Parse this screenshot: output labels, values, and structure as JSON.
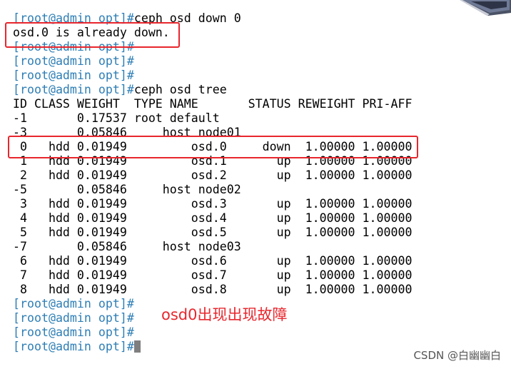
{
  "terminal": {
    "prompt_text": "[root@admin opt]#",
    "lines": {
      "l0": {
        "prompt": "[root@admin opt]#",
        "cmd": "ceph osd down 0"
      },
      "l1": {
        "text": "osd.0 is already down."
      },
      "l2": {
        "prompt": "[root@admin opt]#",
        "cmd": ""
      },
      "l3": {
        "prompt": "[root@admin opt]#",
        "cmd": ""
      },
      "l4": {
        "prompt": "[root@admin opt]#",
        "cmd": ""
      },
      "l5": {
        "prompt": "[root@admin opt]#",
        "cmd": "ceph osd tree"
      },
      "l6": {
        "text": "ID CLASS WEIGHT  TYPE NAME       STATUS REWEIGHT PRI-AFF"
      },
      "l7": {
        "text": "-1       0.17537 root default"
      },
      "l8": {
        "text": "-3       0.05846     host node01"
      },
      "l9": {
        "text": " 0   hdd 0.01949         osd.0     down  1.00000 1.00000"
      },
      "l10": {
        "text": " 1   hdd 0.01949         osd.1       up  1.00000 1.00000"
      },
      "l11": {
        "text": " 2   hdd 0.01949         osd.2       up  1.00000 1.00000"
      },
      "l12": {
        "text": "-5       0.05846     host node02"
      },
      "l13": {
        "text": " 3   hdd 0.01949         osd.3       up  1.00000 1.00000"
      },
      "l14": {
        "text": " 4   hdd 0.01949         osd.4       up  1.00000 1.00000"
      },
      "l15": {
        "text": " 5   hdd 0.01949         osd.5       up  1.00000 1.00000"
      },
      "l16": {
        "text": "-7       0.05846     host node03"
      },
      "l17": {
        "text": " 6   hdd 0.01949         osd.6       up  1.00000 1.00000"
      },
      "l18": {
        "text": " 7   hdd 0.01949         osd.7       up  1.00000 1.00000"
      },
      "l19": {
        "text": " 8   hdd 0.01949         osd.8       up  1.00000 1.00000"
      },
      "l20": {
        "prompt": "[root@admin opt]#",
        "cmd": ""
      },
      "l21": {
        "prompt": "[root@admin opt]#",
        "cmd": ""
      },
      "l22": {
        "prompt": "[root@admin opt]#",
        "cmd": ""
      },
      "l23": {
        "prompt": "[root@admin opt]#",
        "cmd": ""
      }
    }
  },
  "annotation": {
    "text": "osd0出现出现故障"
  },
  "watermark": {
    "text": "CSDN @白幽幽白"
  },
  "colors": {
    "prompt": "#2e7eb5",
    "highlight": "#e8262d",
    "text": "#000000",
    "background": "#ffffff"
  }
}
